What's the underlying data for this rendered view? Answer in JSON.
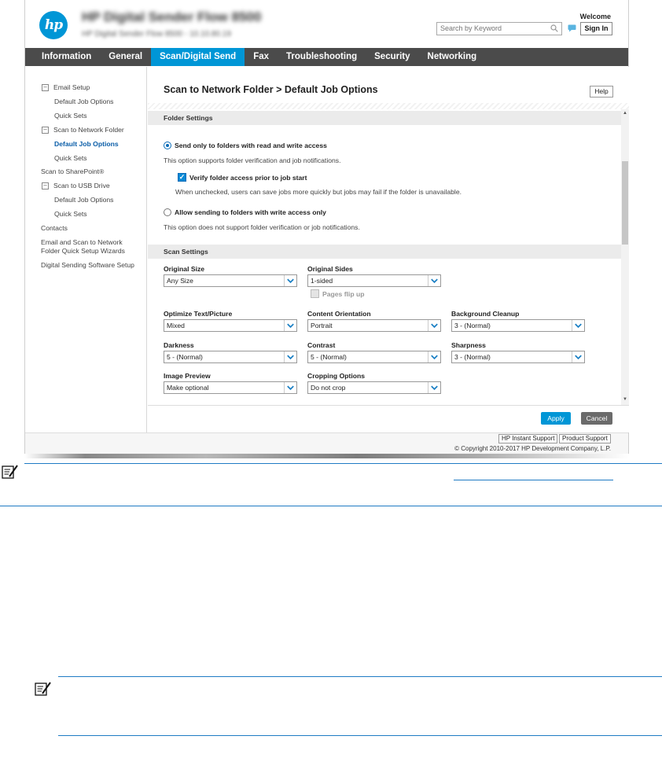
{
  "header": {
    "device_name": "HP Digital Sender Flow 8500",
    "device_sub": "HP Digital Sender Flow 8500  -  10.10.80.19",
    "welcome": "Welcome",
    "search_placeholder": "Search by Keyword",
    "sign_in": "Sign In",
    "logo_text": "hp"
  },
  "nav": {
    "tabs": [
      "Information",
      "General",
      "Scan/Digital Send",
      "Fax",
      "Troubleshooting",
      "Security",
      "Networking"
    ],
    "active": "Scan/Digital Send"
  },
  "sidebar": {
    "items": [
      {
        "label": "Email Setup",
        "collapsible": true
      },
      {
        "label": "Default Job Options"
      },
      {
        "label": "Quick Sets"
      },
      {
        "label": "Scan to Network Folder",
        "collapsible": true
      },
      {
        "label": "Default Job Options",
        "selected": true
      },
      {
        "label": "Quick Sets"
      },
      {
        "label": "Scan to SharePoint®"
      },
      {
        "label": "Scan to USB Drive",
        "collapsible": true
      },
      {
        "label": "Default Job Options"
      },
      {
        "label": "Quick Sets"
      },
      {
        "label": "Contacts"
      },
      {
        "label": "Email and Scan to Network"
      },
      {
        "label": "Folder Quick Setup Wizards"
      },
      {
        "label": "Digital Sending Software Setup"
      }
    ]
  },
  "main": {
    "title": "Scan to Network Folder > Default Job Options",
    "help": "Help",
    "folder_settings": {
      "header": "Folder Settings",
      "option1": "Send only to folders with read and write access",
      "option1_hint": "This option supports folder verification and job notifications.",
      "verify_label": "Verify folder access prior to job start",
      "verify_hint": "When unchecked, users can save jobs more quickly but jobs may fail if the folder is unavailable.",
      "option2": "Allow sending to folders with write access only",
      "option2_hint": "This option does not support folder verification or job notifications."
    },
    "scan_settings": {
      "header": "Scan Settings",
      "original_size_label": "Original Size",
      "original_size": "Any Size",
      "original_sides_label": "Original Sides",
      "original_sides": "1-sided",
      "pages_flip_up": "Pages flip up",
      "optimize_label": "Optimize Text/Picture",
      "optimize": "Mixed",
      "orientation_label": "Content Orientation",
      "orientation": "Portrait",
      "bg_cleanup_label": "Background Cleanup",
      "bg_cleanup": "3 - (Normal)",
      "darkness_label": "Darkness",
      "darkness": "5 - (Normal)",
      "contrast_label": "Contrast",
      "contrast": "5 - (Normal)",
      "sharpness_label": "Sharpness",
      "sharpness": "3 - (Normal)",
      "image_preview_label": "Image Preview",
      "image_preview": "Make optional",
      "cropping_label": "Cropping Options",
      "cropping": "Do not crop"
    },
    "apply": "Apply",
    "cancel": "Cancel"
  },
  "footer": {
    "instant_support": "HP Instant Support",
    "product_support": "Product Support",
    "copyright": "© Copyright 2010-2017 HP Development Company, L.P."
  },
  "colors": {
    "accent": "#0096d6",
    "nav_bg": "#4b4b4b",
    "rule": "#1f7bc4"
  }
}
